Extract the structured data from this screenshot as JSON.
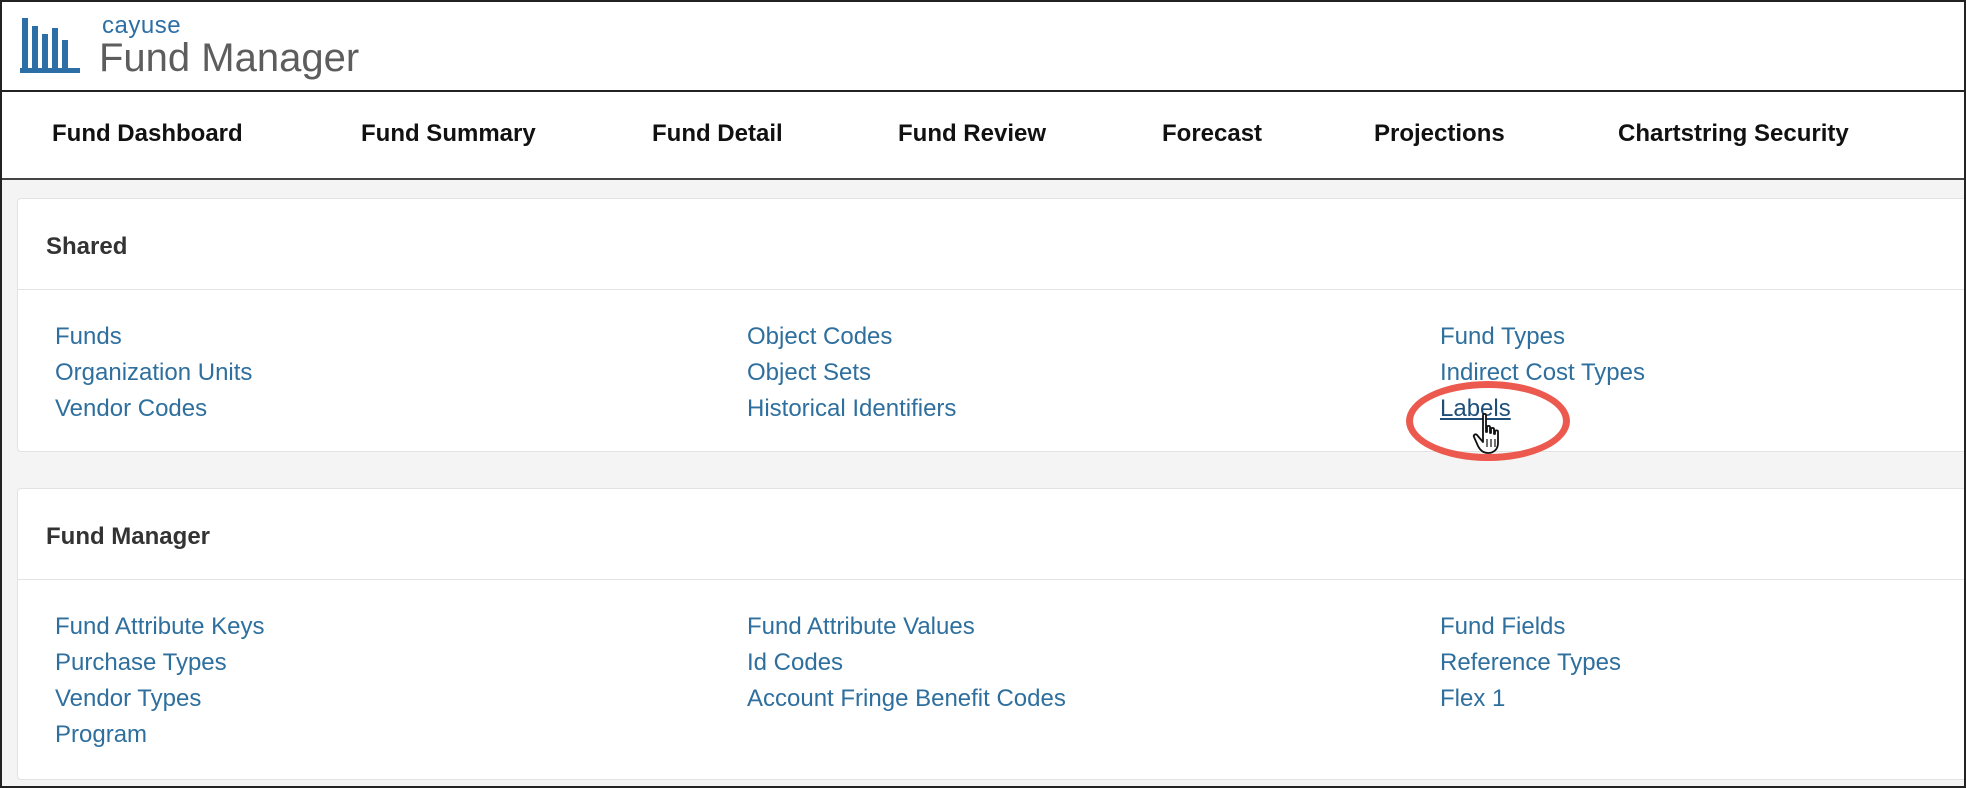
{
  "brand": {
    "company": "cayuse",
    "product": "Fund Manager",
    "accent_color": "#2c6fa6"
  },
  "nav": {
    "items": [
      {
        "label": "Fund Dashboard"
      },
      {
        "label": "Fund Summary"
      },
      {
        "label": "Fund Detail"
      },
      {
        "label": "Fund Review"
      },
      {
        "label": "Forecast"
      },
      {
        "label": "Projections"
      },
      {
        "label": "Chartstring Security"
      }
    ]
  },
  "sections": [
    {
      "title": "Shared",
      "links": [
        "Funds",
        "Organization Units",
        "Vendor Codes",
        "Object Codes",
        "Object Sets",
        "Historical Identifiers",
        "Fund Types",
        "Indirect Cost Types",
        "Labels"
      ]
    },
    {
      "title": "Fund Manager",
      "links": [
        "Fund Attribute Keys",
        "Purchase Types",
        "Vendor Types",
        "Program",
        "Fund Attribute Values",
        "Id Codes",
        "Account Fringe Benefit Codes",
        "Fund Fields",
        "Reference Types",
        "Flex 1"
      ]
    }
  ],
  "annotation": {
    "highlighted_link": "Labels",
    "highlight_color": "#ec5a4f",
    "cursor": "hand-pointer-icon"
  },
  "link_color": "#2e6f9e"
}
